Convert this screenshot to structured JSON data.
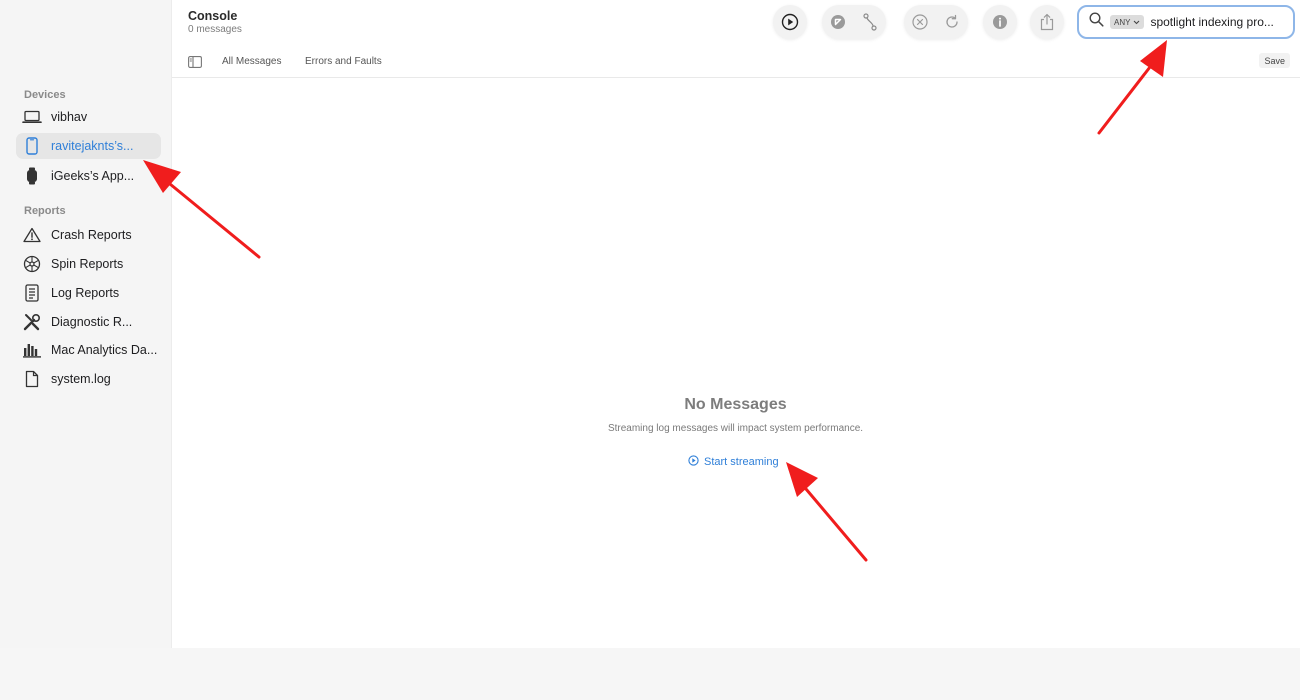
{
  "header": {
    "title": "Console",
    "subtitle": "0 messages"
  },
  "sidebar": {
    "devices_title": "Devices",
    "devices": [
      {
        "label": "vibhav",
        "icon": "laptop-icon"
      },
      {
        "label": "ravitejaknts’s...",
        "icon": "iphone-icon",
        "selected": true
      },
      {
        "label": "iGeeks’s App...",
        "icon": "watch-icon"
      }
    ],
    "reports_title": "Reports",
    "reports": [
      {
        "label": "Crash Reports",
        "icon": "warning-triangle-icon"
      },
      {
        "label": "Spin Reports",
        "icon": "spin-wheel-icon"
      },
      {
        "label": "Log Reports",
        "icon": "document-list-icon"
      },
      {
        "label": "Diagnostic R...",
        "icon": "tools-icon"
      },
      {
        "label": "Mac Analytics Da...",
        "icon": "bar-chart-icon"
      },
      {
        "label": "system.log",
        "icon": "document-icon"
      }
    ]
  },
  "toolbar": {
    "icons": [
      "play-icon",
      "arrow-up-left-icon",
      "path-icon",
      "clear-icon",
      "reload-icon",
      "info-icon",
      "share-icon"
    ]
  },
  "search": {
    "scope": "ANY",
    "query": "spotlight indexing pro..."
  },
  "tabs": {
    "all": "All Messages",
    "errors": "Errors and Faults",
    "save": "Save"
  },
  "empty_state": {
    "title": "No Messages",
    "subtitle": "Streaming log messages will impact system performance.",
    "action": "Start streaming"
  },
  "colors": {
    "accent": "#2f7fd8",
    "annotation": "#f01d1d",
    "search_border": "#8eb6e8"
  }
}
